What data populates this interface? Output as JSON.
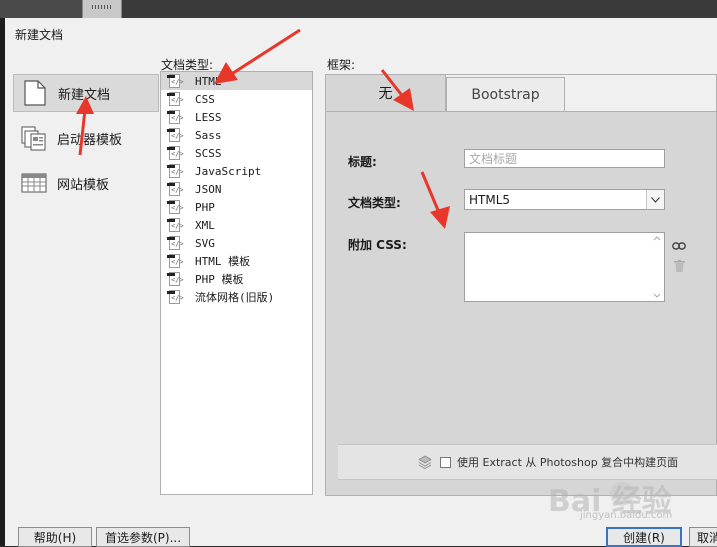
{
  "dialog": {
    "title": "新建文档"
  },
  "categories": [
    {
      "label": "新建文档",
      "icon": "blank-document-icon",
      "selected": true
    },
    {
      "label": "启动器模板",
      "icon": "starter-template-icon",
      "selected": false
    },
    {
      "label": "网站模板",
      "icon": "site-template-icon",
      "selected": false
    }
  ],
  "doctype": {
    "label": "文档类型:",
    "items": [
      "HTML",
      "CSS",
      "LESS",
      "Sass",
      "SCSS",
      "JavaScript",
      "JSON",
      "PHP",
      "XML",
      "SVG",
      "HTML 模板",
      "PHP 模板",
      "流体网格(旧版)"
    ],
    "selected_index": 0
  },
  "framework": {
    "label": "框架:",
    "tabs": [
      "无",
      "Bootstrap"
    ],
    "title_label": "标题:",
    "title_placeholder": "文档标题",
    "doctype_label": "文档类型:",
    "doctype_value": "HTML5",
    "css_label": "附加 CSS:",
    "extract_text": "使用 Extract 从 Photoshop 复合中构建页面"
  },
  "buttons": {
    "help": "帮助(H)",
    "prefs": "首选参数(P)...",
    "create": "创建(R)",
    "cancel": "取消"
  },
  "watermark": {
    "brand": "Bai  经验",
    "url": "jingyan.baidu.com"
  },
  "colors": {
    "annotation_arrow": "#e8372a",
    "create_button_border": "#3a73c4"
  }
}
